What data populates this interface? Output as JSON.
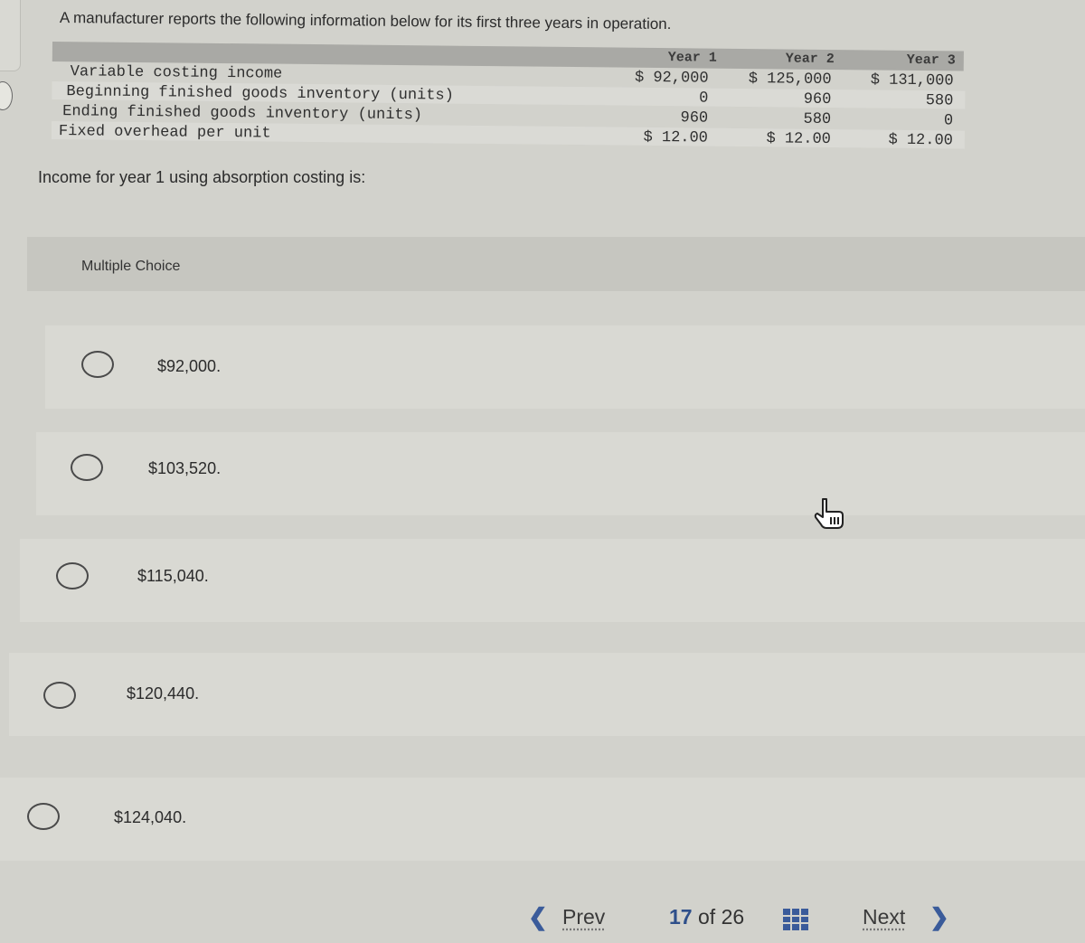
{
  "intro_text": "A manufacturer reports the following information below for its first three years in operation.",
  "table": {
    "columns": [
      "Year 1",
      "Year 2",
      "Year 3"
    ],
    "rows": [
      {
        "label": "Variable costing income",
        "values": [
          "$ 92,000",
          "$ 125,000",
          "$ 131,000"
        ]
      },
      {
        "label": "Beginning finished goods inventory (units)",
        "values": [
          "0",
          "960",
          "580"
        ]
      },
      {
        "label": "Ending finished goods inventory (units)",
        "values": [
          "960",
          "580",
          "0"
        ]
      },
      {
        "label": "Fixed overhead per unit",
        "values": [
          "$ 12.00",
          "$ 12.00",
          "$ 12.00"
        ]
      }
    ]
  },
  "question_text": "Income for year 1 using absorption costing is:",
  "multiple_choice": {
    "title": "Multiple Choice",
    "options": [
      "$92,000.",
      "$103,520.",
      "$115,040.",
      "$120,440.",
      "$124,040."
    ],
    "selected": null
  },
  "navigation": {
    "prev_label": "Prev",
    "next_label": "Next",
    "current_page": "17",
    "of_label": "of",
    "total_pages": "26"
  },
  "colors": {
    "accent": "#3a5b9a",
    "background": "#d2d2cc"
  }
}
